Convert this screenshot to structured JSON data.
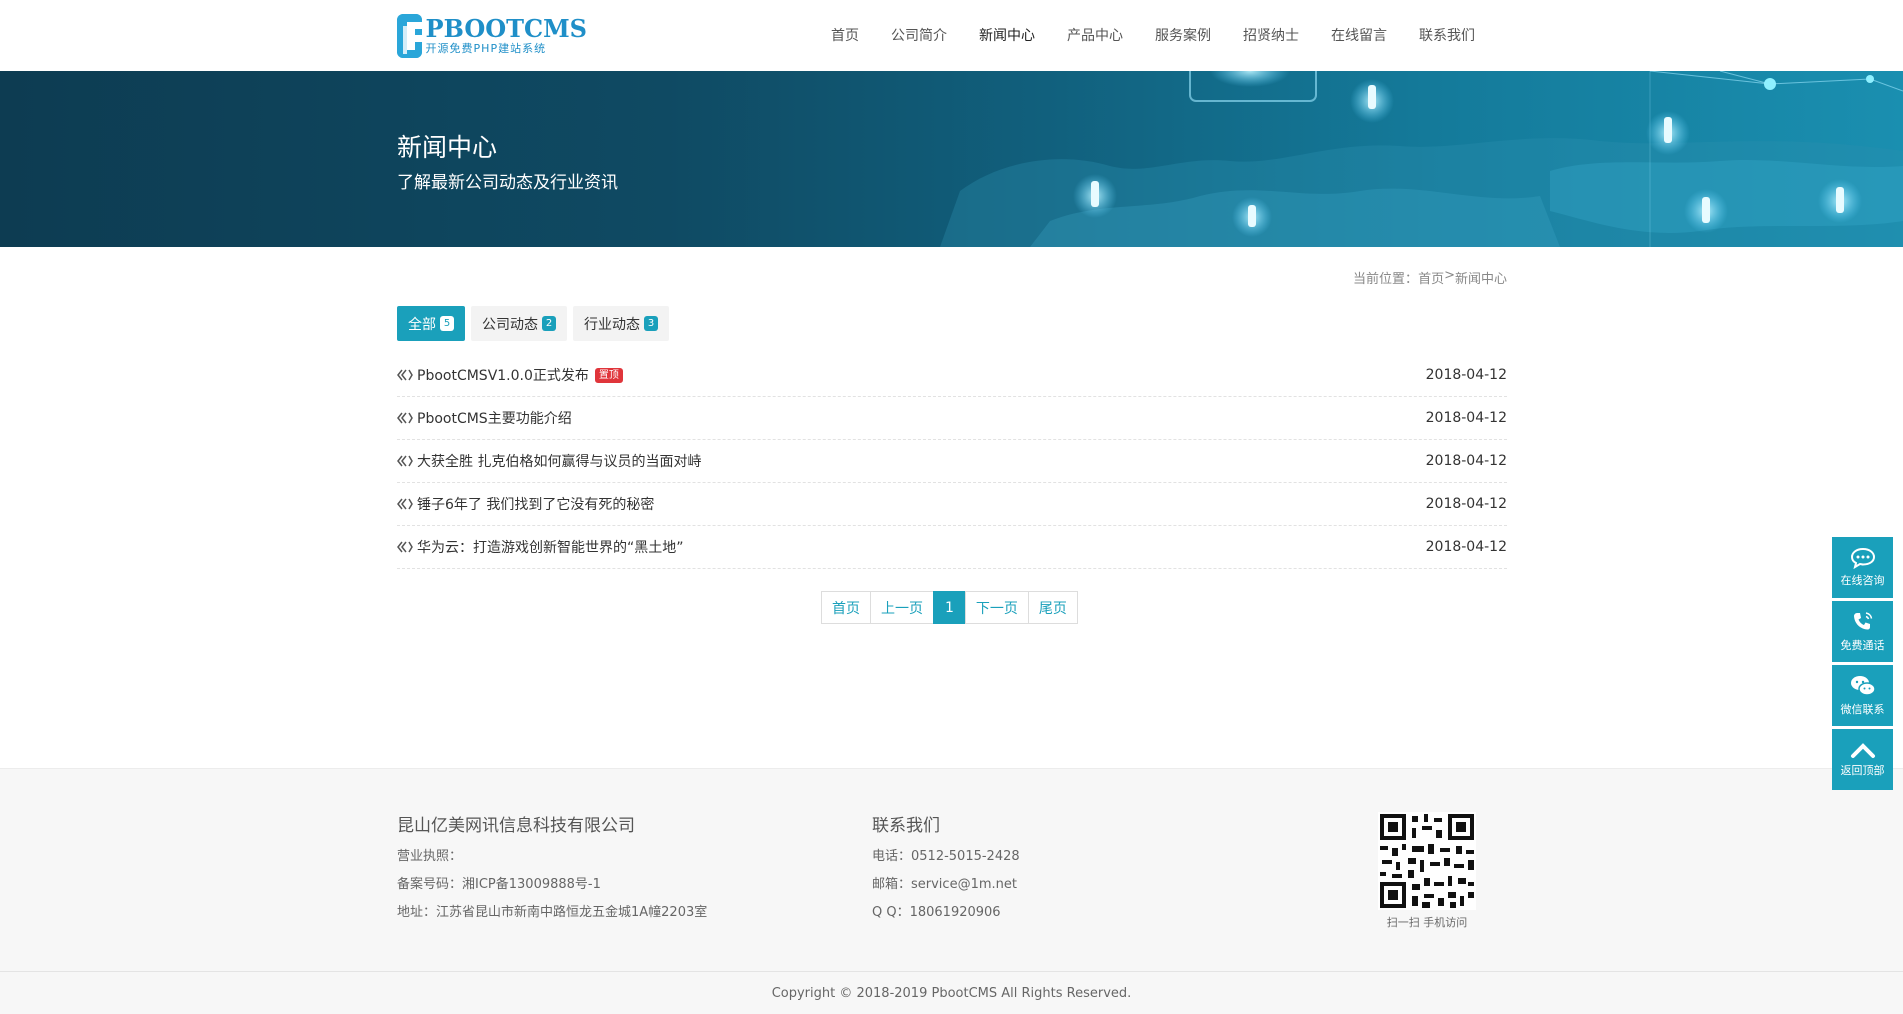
{
  "header": {
    "logo_title": "PBOOTCMS",
    "logo_sub": "开源免费PHP建站系统",
    "nav": [
      "首页",
      "公司简介",
      "新闻中心",
      "产品中心",
      "服务案例",
      "招贤纳士",
      "在线留言",
      "联系我们"
    ],
    "active_nav": "新闻中心"
  },
  "banner": {
    "title": "新闻中心",
    "subtitle": "了解最新公司动态及行业资讯"
  },
  "breadcrumb": {
    "prefix": "当前位置：",
    "home": "首页",
    "sep": ">",
    "current": "新闻中心"
  },
  "tabs": [
    {
      "label": "全部",
      "count": "5"
    },
    {
      "label": "公司动态",
      "count": "2"
    },
    {
      "label": "行业动态",
      "count": "3"
    }
  ],
  "news": [
    {
      "title": "PbootCMSV1.0.0正式发布",
      "badge": "置顶",
      "date": "2018-04-12"
    },
    {
      "title": "PbootCMS主要功能介绍",
      "badge": "",
      "date": "2018-04-12"
    },
    {
      "title": "大获全胜 扎克伯格如何赢得与议员的当面对峙",
      "badge": "",
      "date": "2018-04-12"
    },
    {
      "title": "锤子6年了 我们找到了它没有死的秘密",
      "badge": "",
      "date": "2018-04-12"
    },
    {
      "title": "华为云：打造游戏创新智能世界的“黑土地”",
      "badge": "",
      "date": "2018-04-12"
    }
  ],
  "pager": {
    "first": "首页",
    "prev": "上一页",
    "current": "1",
    "next": "下一页",
    "last": "尾页"
  },
  "footer": {
    "company": "昆山亿美网讯信息科技有限公司",
    "license": "营业执照：",
    "icp": "备案号码：湘ICP备13009888号-1",
    "address": "地址：江苏省昆山市新南中路恒龙五金城1A幢2203室",
    "contact_head": "联系我们",
    "phone": "电话：0512-5015-2428",
    "email": "邮箱：service@1m.net",
    "qq": "Q  Q：18061920906",
    "qr_caption": "扫一扫 手机访问",
    "copyright": "Copyright © 2018-2019 PbootCMS All Rights Reserved."
  },
  "side": [
    {
      "label": "在线咨询",
      "icon": "chat-icon"
    },
    {
      "label": "免费通话",
      "icon": "phone-icon"
    },
    {
      "label": "微信联系",
      "icon": "wechat-icon"
    },
    {
      "label": "返回顶部",
      "icon": "chevron-up-icon"
    }
  ],
  "colors": {
    "accent": "#1aa0bb",
    "badge_red": "#e0353b",
    "banner_dark": "#0d3c52"
  }
}
